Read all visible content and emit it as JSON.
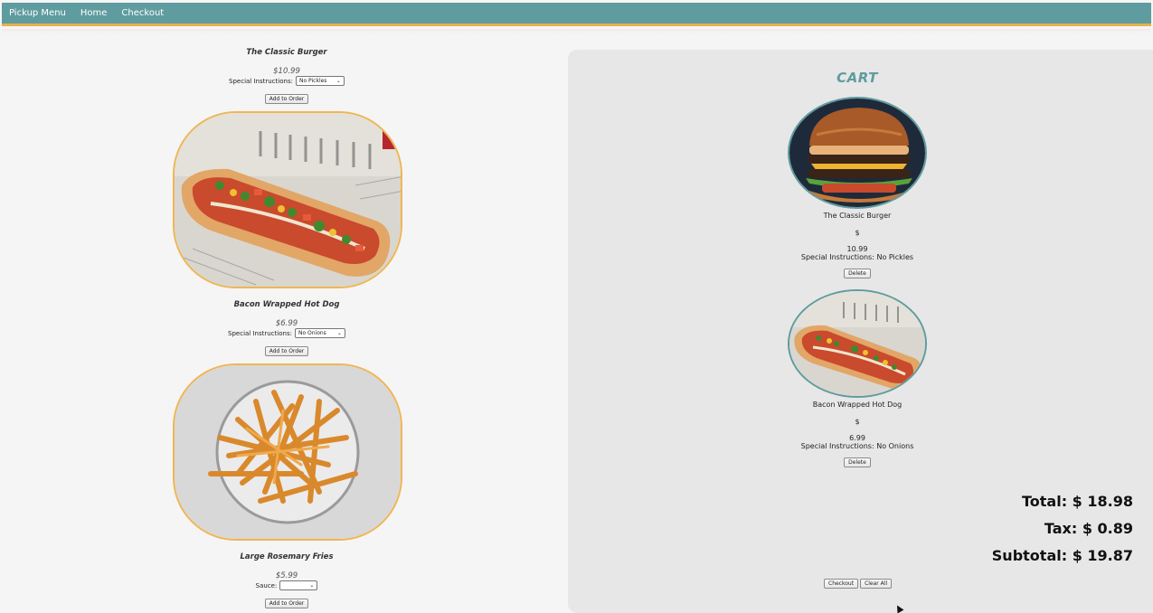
{
  "nav": {
    "items": [
      "Pickup Menu",
      "Home",
      "Checkout"
    ]
  },
  "menu": {
    "items": [
      {
        "title": "The Classic Burger",
        "price": "$10.99",
        "option_label": "Special Instructions:",
        "option_value": "No Pickles",
        "button": "Add to Order",
        "image_icon": "burger-photo"
      },
      {
        "title": "Bacon Wrapped Hot Dog",
        "price": "$6.99",
        "option_label": "Special Instructions:",
        "option_value": "No Onions",
        "button": "Add to Order",
        "image_icon": "hotdog-photo"
      },
      {
        "title": "Large Rosemary Fries",
        "price": "$5.99",
        "option_label": "Sauce:",
        "option_value": "",
        "button": "Add to Order",
        "image_icon": "fries-photo"
      }
    ]
  },
  "cart": {
    "title": "CART",
    "items": [
      {
        "name": "The Classic Burger",
        "currency": "$",
        "price": "10.99",
        "instructions": "Special Instructions: No Pickles",
        "delete": "Delete"
      },
      {
        "name": "Bacon Wrapped Hot Dog",
        "currency": "$",
        "price": "6.99",
        "instructions": "Special Instructions: No Onions",
        "delete": "Delete"
      }
    ],
    "total": "Total: $ 18.98",
    "tax": "Tax: $ 0.89",
    "subtotal": "Subtotal: $ 19.87",
    "checkout": "Checkout",
    "clear_all": "Clear All"
  },
  "colors": {
    "nav": "#5f9c9f",
    "accent": "#efb653",
    "cart_bg": "#e7e7e7"
  }
}
